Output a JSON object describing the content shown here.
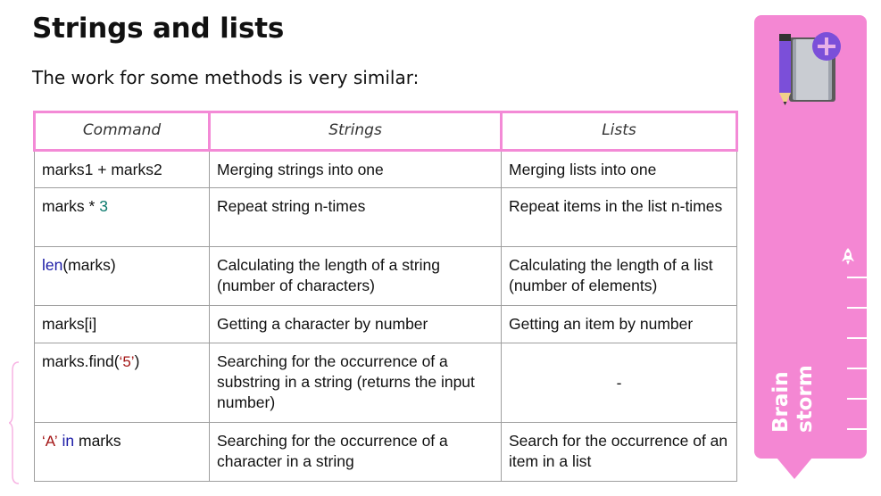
{
  "title": "Strings and lists",
  "subtitle": "The work for some methods is very similar:",
  "table": {
    "headers": [
      "Command",
      "Strings",
      "Lists"
    ],
    "rows": [
      {
        "command": {
          "a": "marks1 + marks2"
        },
        "strings": "Merging strings into one",
        "lists": "Merging lists into one"
      },
      {
        "command": {
          "a": "marks * ",
          "num": "3"
        },
        "strings": "Repeat string n-times",
        "lists": "Repeat items in the list n-times"
      },
      {
        "command": {
          "kw": "len",
          "a": "(marks)"
        },
        "strings": "Calculating the length of a string (number of characters)",
        "lists": "Calculating the length of a list (number of elements)"
      },
      {
        "command": {
          "a": "marks[i]"
        },
        "strings": "Getting a character by number",
        "lists": "Getting an item by number"
      },
      {
        "command": {
          "a": "marks.find(",
          "str": "‘5’",
          "b": ")"
        },
        "strings": "Searching for the occurrence of a substring in a string (returns the input number)",
        "lists": "-"
      },
      {
        "command": {
          "str": "‘A’",
          "kw": " in",
          "a": " marks"
        },
        "strings": "Searching for the occurrence of a character in a string",
        "lists": "Search for the occurrence of an item in a list"
      }
    ]
  },
  "panel": {
    "label_line1": "Brain",
    "label_line2": "storm",
    "color": "#f487d3",
    "icons": [
      "notebook-pencil-plus-icon",
      "rocket-icon"
    ]
  },
  "colors": {
    "header_border": "#f38ad6",
    "keyword": "#1a1aa6",
    "number": "#0b7a6d",
    "string_literal": "#a31515"
  }
}
